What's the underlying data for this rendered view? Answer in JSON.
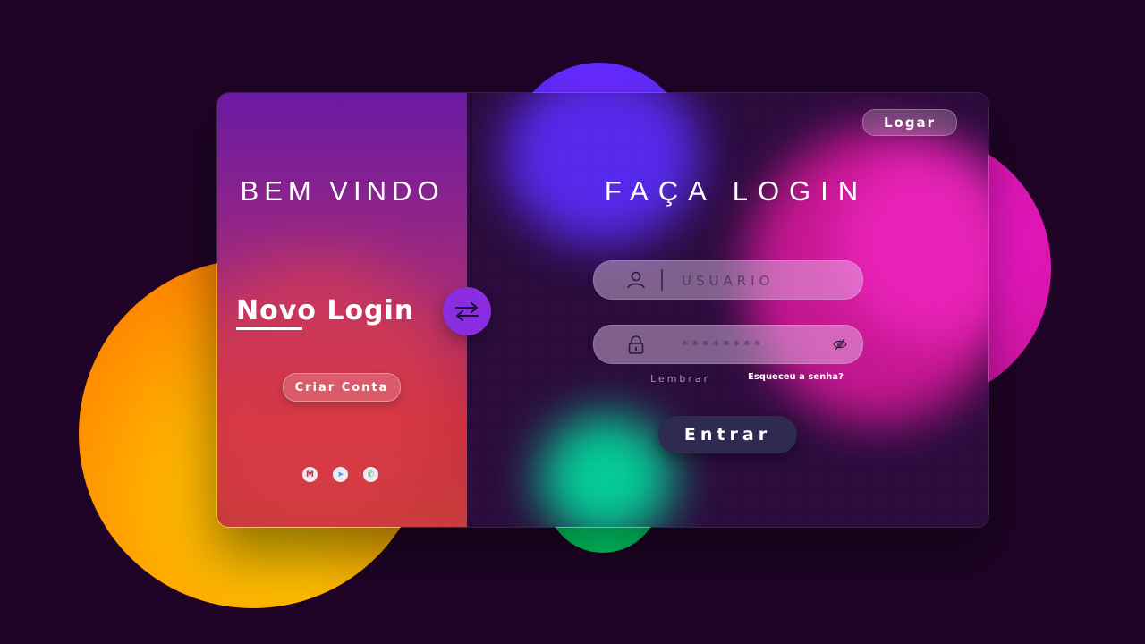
{
  "left_panel": {
    "welcome_title": "BEM VINDO",
    "new_login_label": "Novo Login",
    "create_account_label": "Criar Conta",
    "socials": [
      {
        "name": "gmail-icon",
        "glyph": "M"
      },
      {
        "name": "telegram-icon",
        "glyph": "➤"
      },
      {
        "name": "whatsapp-icon",
        "glyph": "✆"
      }
    ]
  },
  "right_panel": {
    "top_button_label": "Logar",
    "title": "FAÇA LOGIN",
    "username": {
      "placeholder": "USUARIO",
      "value": ""
    },
    "password": {
      "placeholder": "********",
      "value": ""
    },
    "remember_label": "Lembrar",
    "forgot_label": "Esqueceu a senha?",
    "submit_label": "Entrar"
  },
  "icons": {
    "swap": "swap-arrows-icon",
    "user": "user-icon",
    "lock": "lock-icon",
    "eye": "eye-slash-icon"
  },
  "colors": {
    "page_bg": "#1f0427",
    "accent_purple": "#8a2ce0",
    "submit_bg": "#2f2a4f"
  }
}
